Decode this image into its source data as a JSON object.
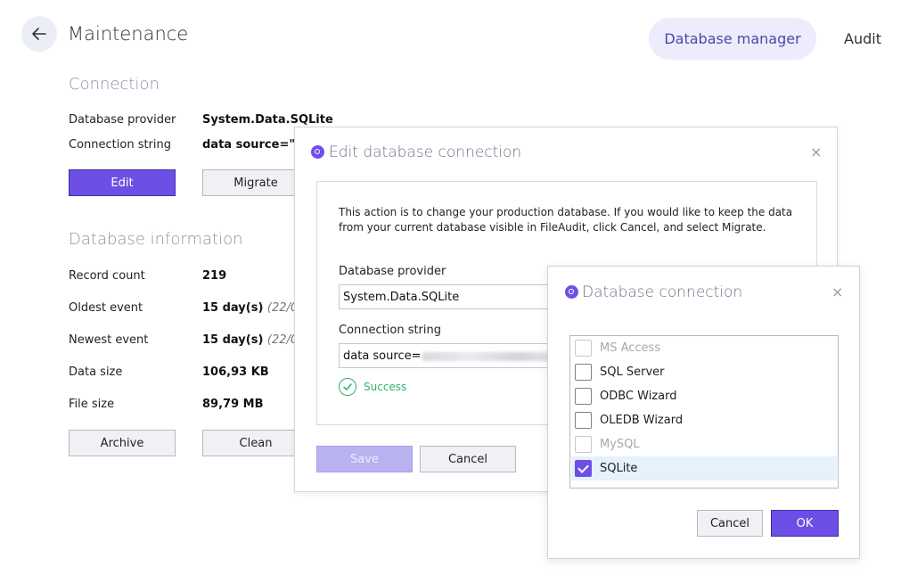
{
  "header": {
    "title": "Maintenance",
    "nav": {
      "database_manager": "Database manager",
      "audit": "Audit"
    }
  },
  "connection": {
    "section_title": "Connection",
    "provider_label": "Database provider",
    "provider_value": "System.Data.SQLite",
    "string_label": "Connection string",
    "string_value": "data source=\"C:\\",
    "edit_button": "Edit",
    "migrate_button": "Migrate"
  },
  "db_info": {
    "section_title": "Database information",
    "rows": [
      {
        "label": "Record count",
        "value": "219",
        "extra": ""
      },
      {
        "label": "Oldest event",
        "value": "15 day(s)",
        "extra": "(22/06/"
      },
      {
        "label": "Newest event",
        "value": "15 day(s)",
        "extra": "(22/06/"
      },
      {
        "label": "Data size",
        "value": "106,93 KB",
        "extra": ""
      },
      {
        "label": "File size",
        "value": "89,79 MB",
        "extra": ""
      }
    ],
    "archive_button": "Archive",
    "clean_button": "Clean"
  },
  "edit_dialog": {
    "title": "Edit database connection",
    "close": "×",
    "description": "This action is to change your production database. If you would like to keep the data from your current database visible in FileAudit, click Cancel, and select Migrate.",
    "provider_label": "Database provider",
    "provider_value": "System.Data.SQLite",
    "string_label": "Connection string",
    "string_value": "data source=",
    "success_text": "Success",
    "save_button": "Save",
    "cancel_button": "Cancel"
  },
  "conn_dialog": {
    "title": "Database connection",
    "close": "×",
    "options": [
      {
        "label": "MS Access",
        "checked": false,
        "disabled": true
      },
      {
        "label": "SQL Server",
        "checked": false,
        "disabled": false
      },
      {
        "label": "ODBC Wizard",
        "checked": false,
        "disabled": false
      },
      {
        "label": "OLEDB Wizard",
        "checked": false,
        "disabled": false
      },
      {
        "label": "MySQL",
        "checked": false,
        "disabled": true
      },
      {
        "label": "SQLite",
        "checked": true,
        "disabled": false
      }
    ],
    "cancel_button": "Cancel",
    "ok_button": "OK"
  },
  "colors": {
    "accent": "#6d4fe6",
    "nav_active_bg": "#ececfc",
    "success": "#2fb36b",
    "selection": "#e5f1fb"
  }
}
